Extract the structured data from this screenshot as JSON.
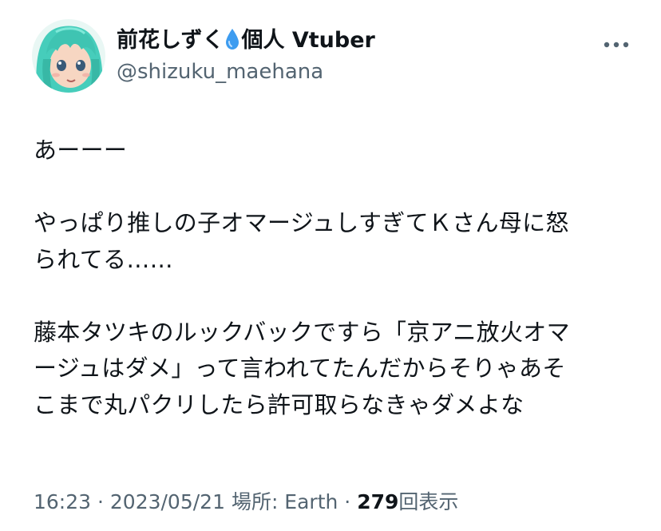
{
  "user": {
    "display_name": "前花しずく",
    "display_suffix": "個人 Vtuber",
    "handle": "@shizuku_maehana",
    "name_emoji": "droplet-icon"
  },
  "tweet": {
    "lines": [
      "あーーー",
      "",
      "やっぱり推しの子オマージュしすぎてＫさん母に怒",
      "られてる……",
      "",
      "藤本タツキのルックバックですら「京アニ放火オマ",
      "ージュはダメ」って言われてたんだからそりゃあそ",
      "こまで丸パクリしたら許可取らなきゃダメよな"
    ]
  },
  "meta": {
    "time": "16:23",
    "separator": " · ",
    "date": "2023/05/21",
    "location_label": "場所: Earth",
    "views_count": "279",
    "views_label": "回表示"
  },
  "colors": {
    "text": "#0f1419",
    "secondary": "#536471",
    "avatar_hair": "#4fd6c4"
  }
}
